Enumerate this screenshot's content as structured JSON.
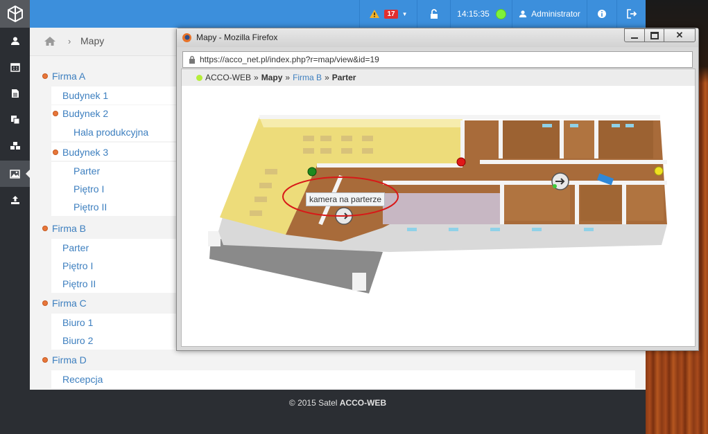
{
  "topbar": {
    "alert_count": "17",
    "time": "14:15:35",
    "user": "Administrator"
  },
  "breadcrumb": {
    "current": "Mapy"
  },
  "tree": {
    "firma_a": "Firma A",
    "budynek1": "Budynek 1",
    "budynek2": "Budynek 2",
    "hala": "Hala produkcyjna",
    "budynek3": "Budynek 3",
    "b3_parter": "Parter",
    "b3_pietro1": "Piętro I",
    "b3_pietro2": "Piętro II",
    "firma_b": "Firma B",
    "fb_parter": "Parter",
    "fb_pietro1": "Piętro I",
    "fb_pietro2": "Piętro II",
    "firma_c": "Firma C",
    "biuro1": "Biuro 1",
    "biuro2": "Biuro 2",
    "firma_d": "Firma D",
    "recepcja": "Recepcja"
  },
  "footer": {
    "prefix": "© 2015 Satel ",
    "brand": "ACCO-WEB"
  },
  "popup": {
    "title": "Mapy - Mozilla Firefox",
    "url": "https://acco_net.pl/index.php?r=map/view&id=19",
    "crumb_root": "ACCO-WEB",
    "crumb_sep": "»",
    "crumb_mapy": "Mapy",
    "crumb_firma": "Firma B",
    "crumb_floor": "Parter",
    "tooltip": "kamera na parterze"
  },
  "colors": {
    "topbar": "#3c8fdc",
    "sidebar": "#2b2e33",
    "link": "#3d7fbf",
    "bullet": "#e7763a",
    "status_online": "#7ef23a",
    "alert_badge": "#e02e2e"
  }
}
